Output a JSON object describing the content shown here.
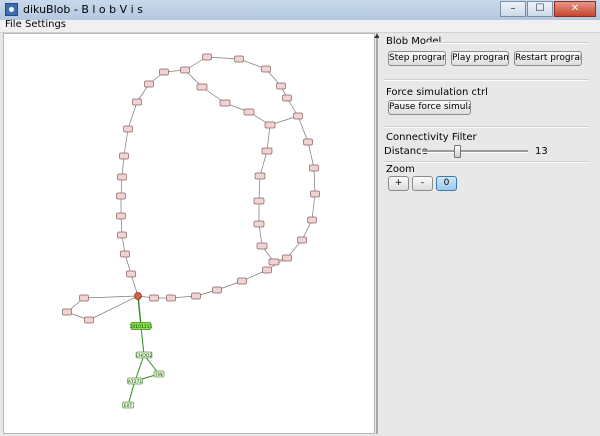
{
  "window": {
    "title": "dikuBlob - B l o b V i s"
  },
  "menu": {
    "items": [
      "File",
      "Settings"
    ]
  },
  "panel": {
    "blob_model": {
      "title": "Blob Model",
      "buttons": [
        "Step program",
        "Play program",
        "Restart program"
      ]
    },
    "force": {
      "title": "Force simulation ctrl",
      "button": "Pause force simulation"
    },
    "connectivity": {
      "title": "Connectivity Filter",
      "label": "Distance",
      "value": "13",
      "slider_value": 13
    },
    "zoom": {
      "title": "Zoom",
      "buttons": [
        "+",
        "-",
        "0"
      ],
      "active": "0"
    }
  },
  "colors": {
    "node_fill": "#f2d3d3",
    "node_stroke": "#8b6060",
    "highlight_fill": "#88e04a",
    "highlight_stroke": "#3c8a1c",
    "hub_node": "#d9604a",
    "edge": "#7a7a7a",
    "green_edge": "#2d8a1d",
    "green_node_fill": "#e7f7dd",
    "green_node_stroke": "#5b9a4a"
  },
  "graph": {
    "green_labels": [
      "10101111",
      "CHOO2",
      "A7271",
      "EXT",
      "FIN"
    ]
  }
}
